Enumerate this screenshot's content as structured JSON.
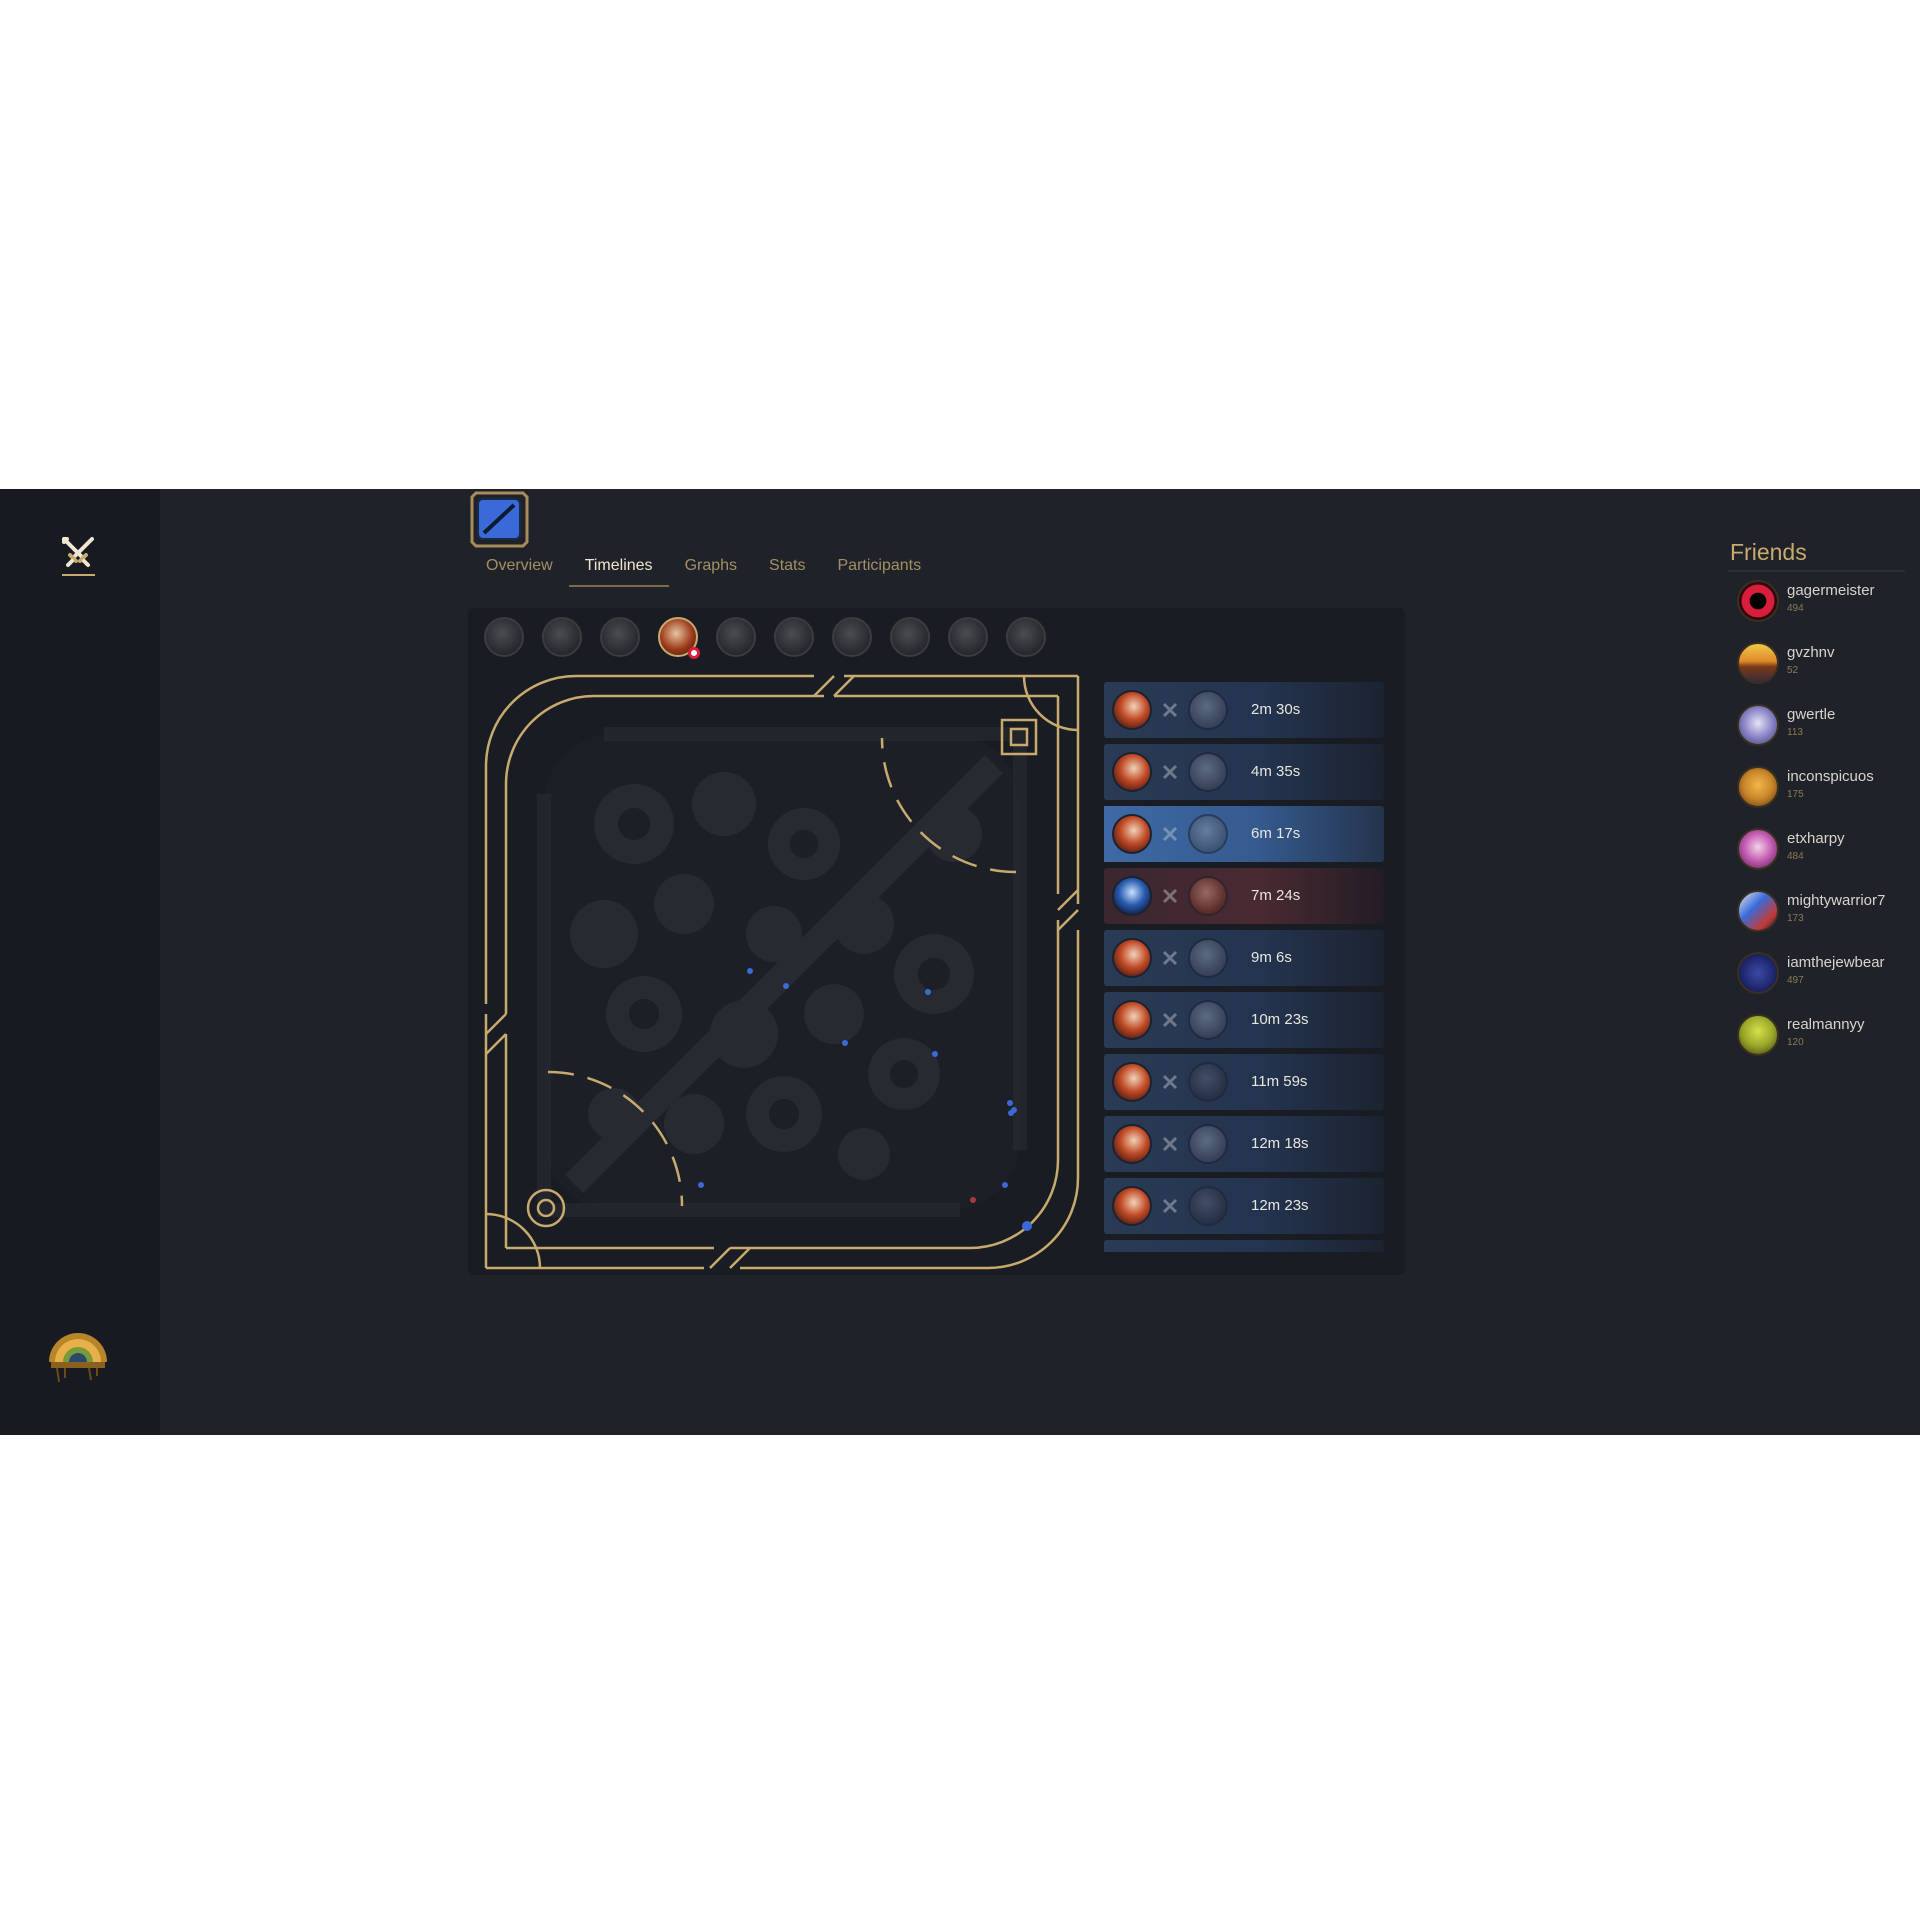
{
  "tabs": [
    {
      "label": "Overview"
    },
    {
      "label": "Timelines"
    },
    {
      "label": "Graphs"
    },
    {
      "label": "Stats"
    },
    {
      "label": "Participants"
    }
  ],
  "active_tab": "Timelines",
  "events": [
    {
      "time": "2m 30s"
    },
    {
      "time": "4m 35s"
    },
    {
      "time": "6m 17s"
    },
    {
      "time": "7m 24s"
    },
    {
      "time": "9m 6s"
    },
    {
      "time": "10m 23s"
    },
    {
      "time": "11m 59s"
    },
    {
      "time": "12m 18s"
    },
    {
      "time": "12m 23s"
    }
  ],
  "friends": {
    "title": "Friends",
    "list": [
      {
        "name": "gagermeister",
        "level": "494",
        "color": "#d81e3a"
      },
      {
        "name": "gvzhnv",
        "level": "52",
        "color": "#e8a23a"
      },
      {
        "name": "gwertle",
        "level": "113",
        "color": "#8a86c8"
      },
      {
        "name": "inconspicuos",
        "level": "175",
        "color": "#c8862a"
      },
      {
        "name": "etxharpy",
        "level": "484",
        "color": "#c25ab0"
      },
      {
        "name": "mightywarrior7",
        "level": "173",
        "color": "#3a6ad8"
      },
      {
        "name": "iamthejewbear",
        "level": "497",
        "color": "#2a3a8a"
      },
      {
        "name": "realmannyy",
        "level": "120",
        "color": "#9aa82a"
      }
    ]
  },
  "colors": {
    "gold": "#c8aa6e",
    "background": "#1f2229",
    "sidebar": "#171b21",
    "blue_team": "#3f6aa6",
    "red_team": "#d81e3a"
  },
  "icons": {
    "logo": "crossed-swords-icon",
    "match": "blue-square-map-icon",
    "event_separator": "sword-icon"
  }
}
